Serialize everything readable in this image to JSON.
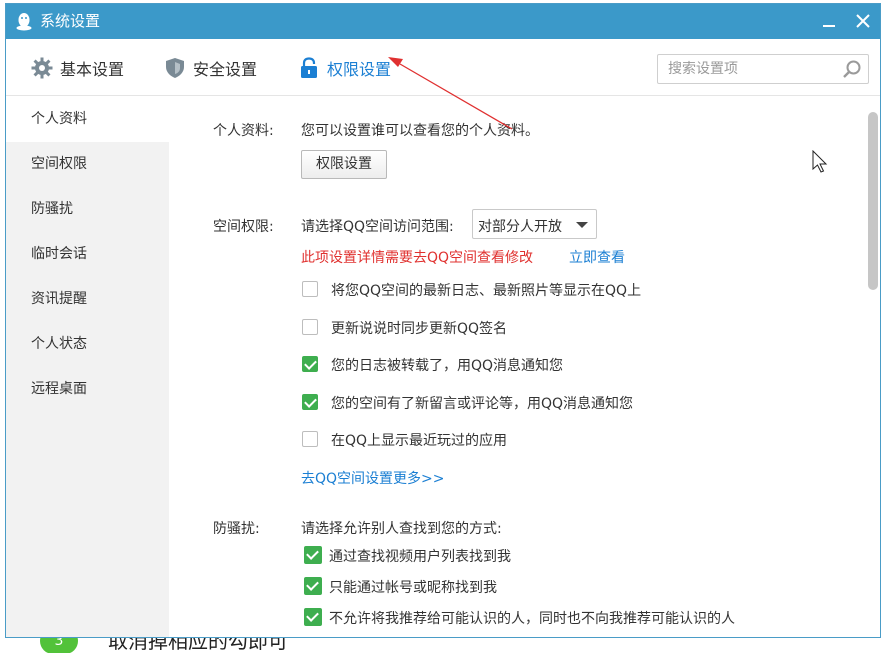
{
  "window": {
    "title": "系统设置"
  },
  "tabs": [
    {
      "label": "基本设置",
      "icon": "gear-icon"
    },
    {
      "label": "安全设置",
      "icon": "shield-icon"
    },
    {
      "label": "权限设置",
      "icon": "lock-icon",
      "active": true
    }
  ],
  "search": {
    "placeholder": "搜索设置项",
    "value": ""
  },
  "sidebar": {
    "items": [
      {
        "label": "个人资料",
        "active": true
      },
      {
        "label": "空间权限"
      },
      {
        "label": "防骚扰"
      },
      {
        "label": "临时会话"
      },
      {
        "label": "资讯提醒"
      },
      {
        "label": "个人状态"
      },
      {
        "label": "远程桌面"
      }
    ]
  },
  "profile": {
    "label": "个人资料:",
    "desc": "您可以设置谁可以查看您的个人资料。",
    "button": "权限设置"
  },
  "space": {
    "label": "空间权限:",
    "prompt": "请选择QQ空间访问范围:",
    "select_value": "对部分人开放",
    "notice": "此项设置详情需要去QQ空间查看修改",
    "notice_link": "立即查看",
    "options": [
      {
        "label": "将您QQ空间的最新日志、最新照片等显示在QQ上",
        "checked": false
      },
      {
        "label": "更新说说时同步更新QQ签名",
        "checked": false
      },
      {
        "label": "您的日志被转载了，用QQ消息通知您",
        "checked": true
      },
      {
        "label": "您的空间有了新留言或评论等，用QQ消息通知您",
        "checked": true
      },
      {
        "label": "在QQ上显示最近玩过的应用",
        "checked": false
      }
    ],
    "more_link": "去QQ空间设置更多>>"
  },
  "antiharass": {
    "label": "防骚扰:",
    "prompt": "请选择允许别人查找到您的方式:",
    "options": [
      {
        "label": "通过查找视频用户列表找到我",
        "checked": true
      },
      {
        "label": "只能通过帐号或昵称找到我",
        "checked": true
      },
      {
        "label": "不允许将我推荐给可能认识的人，同时也不向我推荐可能认识的人",
        "checked": true
      }
    ]
  },
  "behind": {
    "badge": "3",
    "text": "取消掉相应的勾即可"
  },
  "colors": {
    "titlebar": "#3b99c9",
    "accent": "#1b7fd3",
    "check": "#3eae4f",
    "warning": "#e0312f",
    "annotation": "#e03030"
  }
}
